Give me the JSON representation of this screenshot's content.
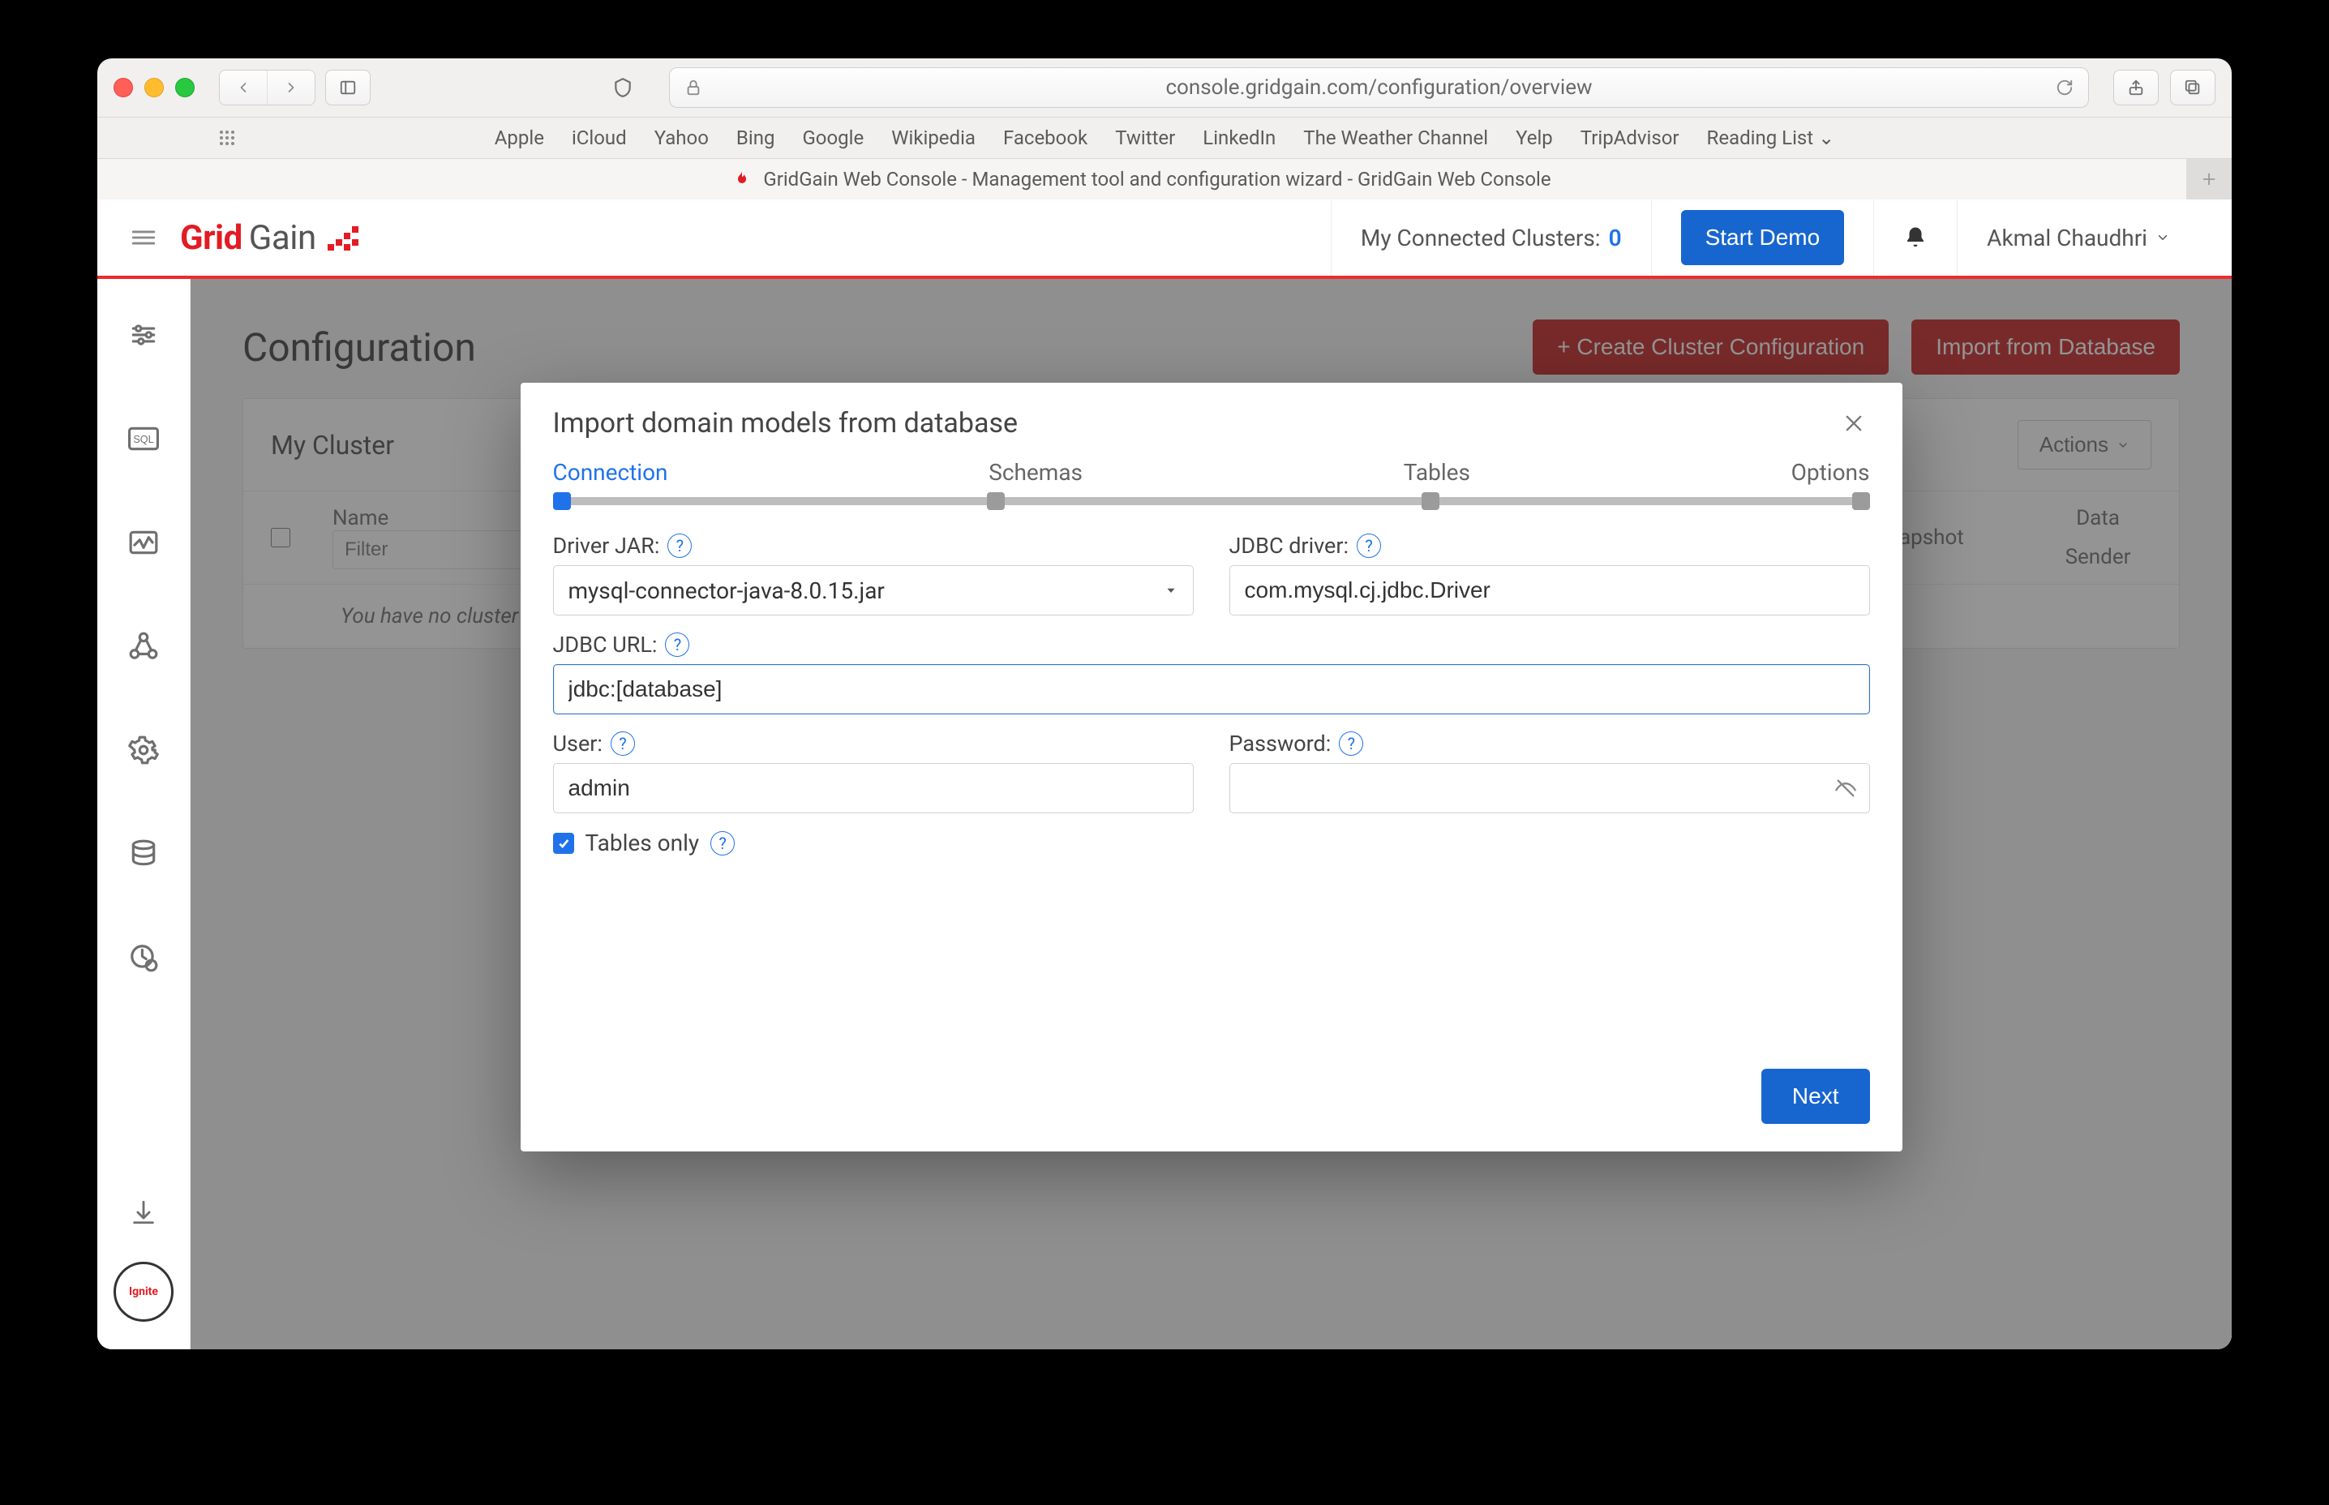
{
  "browser": {
    "url": "console.gridgain.com/configuration/overview",
    "bookmarks": [
      "Apple",
      "iCloud",
      "Yahoo",
      "Bing",
      "Google",
      "Wikipedia",
      "Facebook",
      "Twitter",
      "LinkedIn",
      "The Weather Channel",
      "Yelp",
      "TripAdvisor",
      "Reading List ⌄"
    ],
    "tab_title": "GridGain Web Console - Management tool and configuration wizard - GridGain Web Console"
  },
  "header": {
    "clusters_label": "My Connected Clusters:",
    "clusters_count": "0",
    "start_demo": "Start Demo",
    "user_name": "Akmal Chaudhri"
  },
  "page": {
    "title": "Configuration",
    "create_cluster_btn": "+ Create Cluster Configuration",
    "import_db_btn": "Import from Database",
    "my_cluster": "My Cluster",
    "actions": "Actions",
    "col_name": "Name",
    "col_snapshot": "Snapshot",
    "col_data": "Data",
    "col_sender": "Sender",
    "filter_placeholder": "Filter",
    "empty_msg": "You have no cluster configurations."
  },
  "modal": {
    "title": "Import domain models from database",
    "steps": [
      "Connection",
      "Schemas",
      "Tables",
      "Options"
    ],
    "driver_jar_label": "Driver JAR:",
    "driver_jar_value": "mysql-connector-java-8.0.15.jar",
    "jdbc_driver_label": "JDBC driver:",
    "jdbc_driver_value": "com.mysql.cj.jdbc.Driver",
    "jdbc_url_label": "JDBC URL:",
    "jdbc_url_value": "jdbc:[database]",
    "user_label": "User:",
    "user_value": "admin",
    "password_label": "Password:",
    "password_value": "",
    "tables_only_label": "Tables only",
    "next": "Next"
  }
}
